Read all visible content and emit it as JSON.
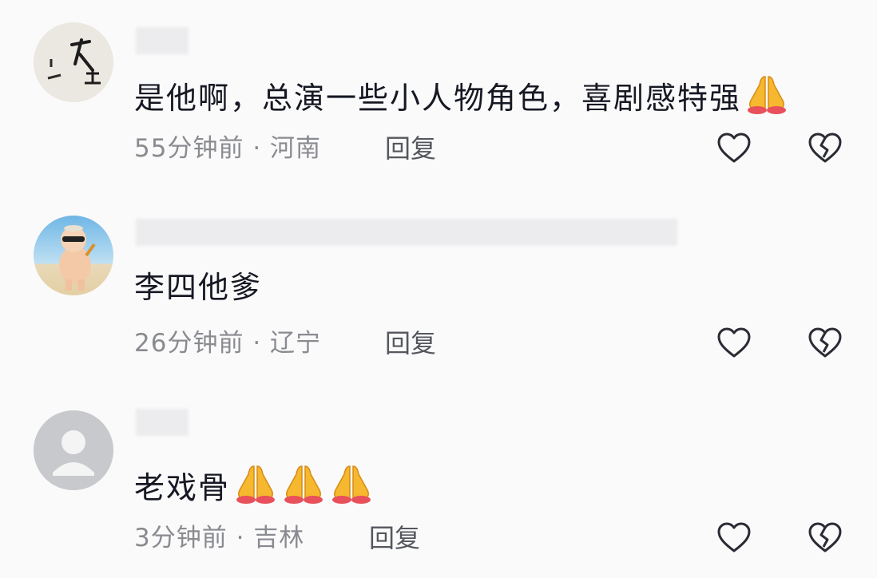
{
  "comments": [
    {
      "avatar_icon": "calligraphy-avatar-icon",
      "text": "是他啊，总演一些小人物角色，喜剧感特强",
      "emoji_count": 1,
      "time": "55分钟前",
      "location": "河南",
      "separator": "·",
      "reply_label": "回复",
      "like_icon": "heart-icon",
      "dislike_icon": "broken-heart-icon"
    },
    {
      "avatar_icon": "cartoon-character-avatar-icon",
      "text": "李四他爹",
      "emoji_count": 0,
      "time": "26分钟前",
      "location": "辽宁",
      "separator": "·",
      "reply_label": "回复",
      "like_icon": "heart-icon",
      "dislike_icon": "broken-heart-icon"
    },
    {
      "avatar_icon": "default-user-avatar-icon",
      "text": "老戏骨",
      "emoji_count": 3,
      "time": "3分钟前",
      "location": "吉林",
      "separator": "·",
      "reply_label": "回复",
      "like_icon": "heart-icon",
      "dislike_icon": "broken-heart-icon"
    }
  ],
  "colors": {
    "background": "#fafafa",
    "text": "#161823",
    "meta": "#8a8b91",
    "emoji": "#f5b82e"
  }
}
